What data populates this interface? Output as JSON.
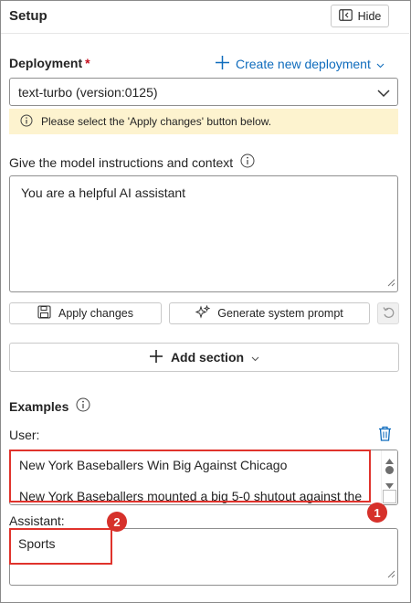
{
  "panel": {
    "title": "Setup",
    "hide_label": "Hide"
  },
  "deployment": {
    "label": "Deployment",
    "required_mark": "*",
    "create_link": "Create new deployment",
    "selected": "text-turbo (version:0125)",
    "notice": "Please select the 'Apply changes' button below."
  },
  "instructions": {
    "label": "Give the model instructions and context",
    "value": "You are a helpful AI assistant"
  },
  "actions": {
    "apply_label": "Apply changes",
    "generate_label": "Generate system prompt",
    "add_section_label": "Add section"
  },
  "examples": {
    "heading": "Examples",
    "user_label": "User:",
    "user_line1": "New York Baseballers Win Big Against Chicago",
    "user_line2": "New York Baseballers mounted a big 5-0 shutout against the",
    "assistant_label": "Assistant:",
    "assistant_value": "Sports"
  },
  "callouts": {
    "one": "1",
    "two": "2"
  },
  "colors": {
    "accent": "#0f6cbd",
    "notice_bg": "#fdf3cf",
    "highlight": "#e0332c"
  },
  "icons": [
    "hide-panel-icon",
    "plus-icon",
    "chevron-down-icon",
    "info-icon",
    "save-icon",
    "sparkle-icon",
    "undo-icon",
    "trash-icon"
  ]
}
